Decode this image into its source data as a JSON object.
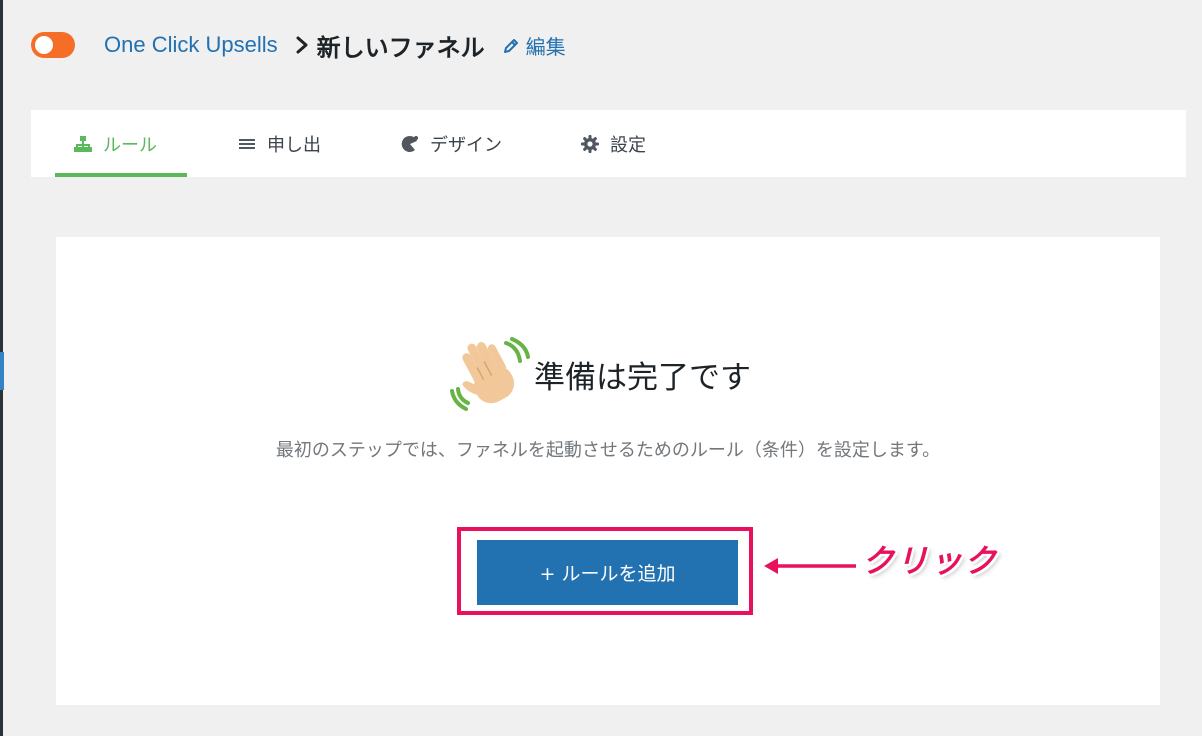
{
  "header": {
    "brand": "One Click Upsells",
    "funnel_title": "新しいファネル",
    "edit_label": "編集"
  },
  "tabs": [
    {
      "label": "ルール",
      "icon": "sitemap-icon",
      "active": true
    },
    {
      "label": "申し出",
      "icon": "list-icon",
      "active": false
    },
    {
      "label": "デザイン",
      "icon": "palette-icon",
      "active": false
    },
    {
      "label": "設定",
      "icon": "gear-icon",
      "active": false
    }
  ],
  "main": {
    "ready_title": "準備は完了です",
    "description": "最初のステップでは、ファネルを起動させるためのルール（条件）を設定します。",
    "add_rule_button": "+ ルールを追加"
  },
  "annotation": {
    "click_label": "クリック"
  },
  "colors": {
    "accent_blue": "#2271b1",
    "active_tab_green": "#5cb85c",
    "toggle_orange": "#f56e28",
    "annotation_pink": "#e8115e"
  }
}
